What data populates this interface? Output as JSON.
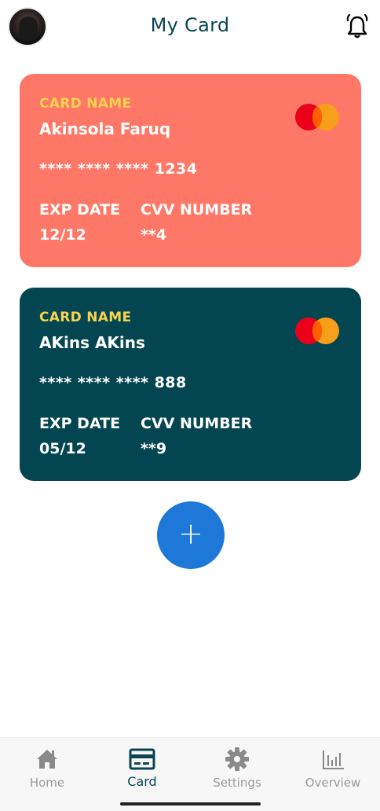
{
  "header": {
    "title": "My Card",
    "avatar_icon": "user-avatar",
    "bell_icon": "bell-icon"
  },
  "cards": [
    {
      "name_label": "CARD NAME",
      "holder": "Akinsola Faruq",
      "number": "**** **** **** 1234",
      "exp_label": "EXP DATE",
      "exp_value": "12/12",
      "cvv_label": "CVV NUMBER",
      "cvv_value": "**4",
      "brand_icon": "mastercard-icon",
      "color": "#ff7867"
    },
    {
      "name_label": "CARD NAME",
      "holder": "AKins AKins",
      "number": "**** **** **** 888",
      "exp_label": "EXP DATE",
      "exp_value": "05/12",
      "cvv_label": "CVV NUMBER",
      "cvv_value": "**9",
      "brand_icon": "mastercard-icon",
      "color": "#034550"
    }
  ],
  "fab": {
    "label": "+",
    "icon": "plus-icon",
    "color": "#1d78d8"
  },
  "nav": {
    "items": [
      {
        "label": "Home",
        "icon": "home-icon",
        "active": false
      },
      {
        "label": "Card",
        "icon": "card-icon",
        "active": true
      },
      {
        "label": "Settings",
        "icon": "gear-icon",
        "active": false
      },
      {
        "label": "Overview",
        "icon": "bar-chart-icon",
        "active": false
      }
    ]
  },
  "colors": {
    "accent": "#0b4452",
    "label_yellow": "#f7d34e"
  }
}
